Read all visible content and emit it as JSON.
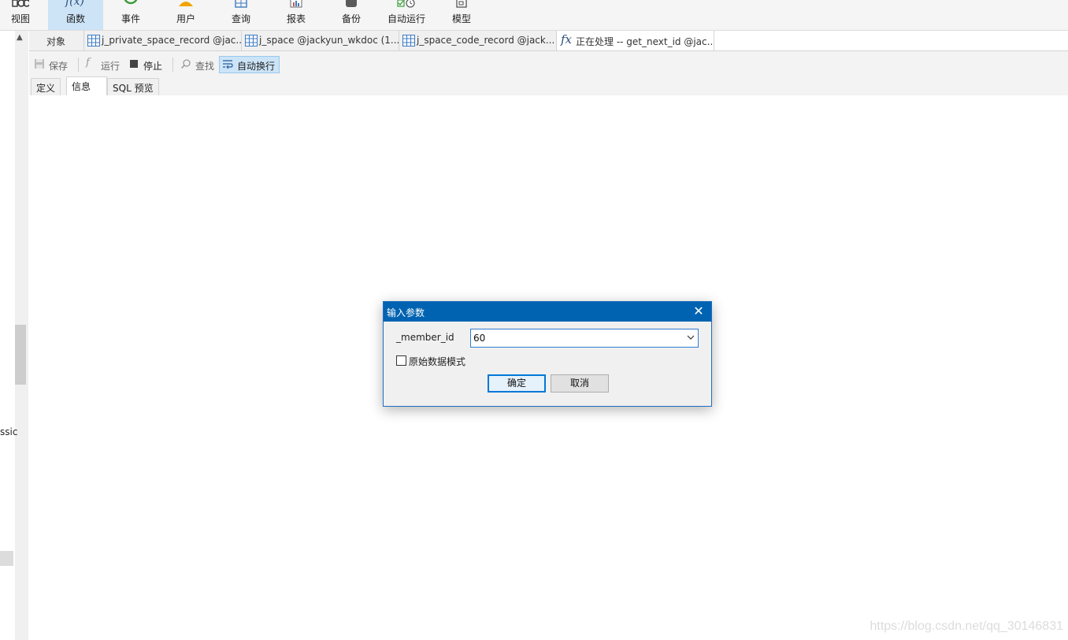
{
  "ribbon": {
    "items": [
      {
        "label": "视图",
        "icon": "view-icon"
      },
      {
        "label": "函数",
        "icon": "function-icon"
      },
      {
        "label": "事件",
        "icon": "event-icon"
      },
      {
        "label": "用户",
        "icon": "user-icon"
      },
      {
        "label": "查询",
        "icon": "query-icon"
      },
      {
        "label": "报表",
        "icon": "report-icon"
      },
      {
        "label": "备份",
        "icon": "backup-icon"
      },
      {
        "label": "自动运行",
        "icon": "auto-run-icon"
      },
      {
        "label": "模型",
        "icon": "model-icon"
      }
    ],
    "active_index": 1
  },
  "left_panel": {
    "partial_text": "ssic"
  },
  "tabs": [
    {
      "label": "对象",
      "type": "objects"
    },
    {
      "label": "j_private_space_record @jac...",
      "type": "table"
    },
    {
      "label": "j_space @jackyun_wkdoc (1...",
      "type": "table"
    },
    {
      "label": "j_space_code_record @jack...",
      "type": "table"
    },
    {
      "label": "正在处理 -- get_next_id @jac...",
      "type": "function"
    }
  ],
  "toolbar": {
    "save_label": "保存",
    "run_label": "运行",
    "stop_label": "停止",
    "find_label": "查找",
    "wrap_label": "自动换行"
  },
  "subtabs": [
    "定义",
    "信息",
    "SQL 预览"
  ],
  "dialog": {
    "title": "输入参数",
    "param_label": "_member_id",
    "param_value": "60",
    "checkbox_label": "原始数据模式",
    "checkbox_checked": false,
    "ok_label": "确定",
    "cancel_label": "取消"
  },
  "watermark": "https://blog.csdn.net/qq_30146831",
  "colors": {
    "accent": "#0063b1",
    "ribbon_active": "#cde4f7",
    "toolbar_toggle": "#cce4f7"
  }
}
